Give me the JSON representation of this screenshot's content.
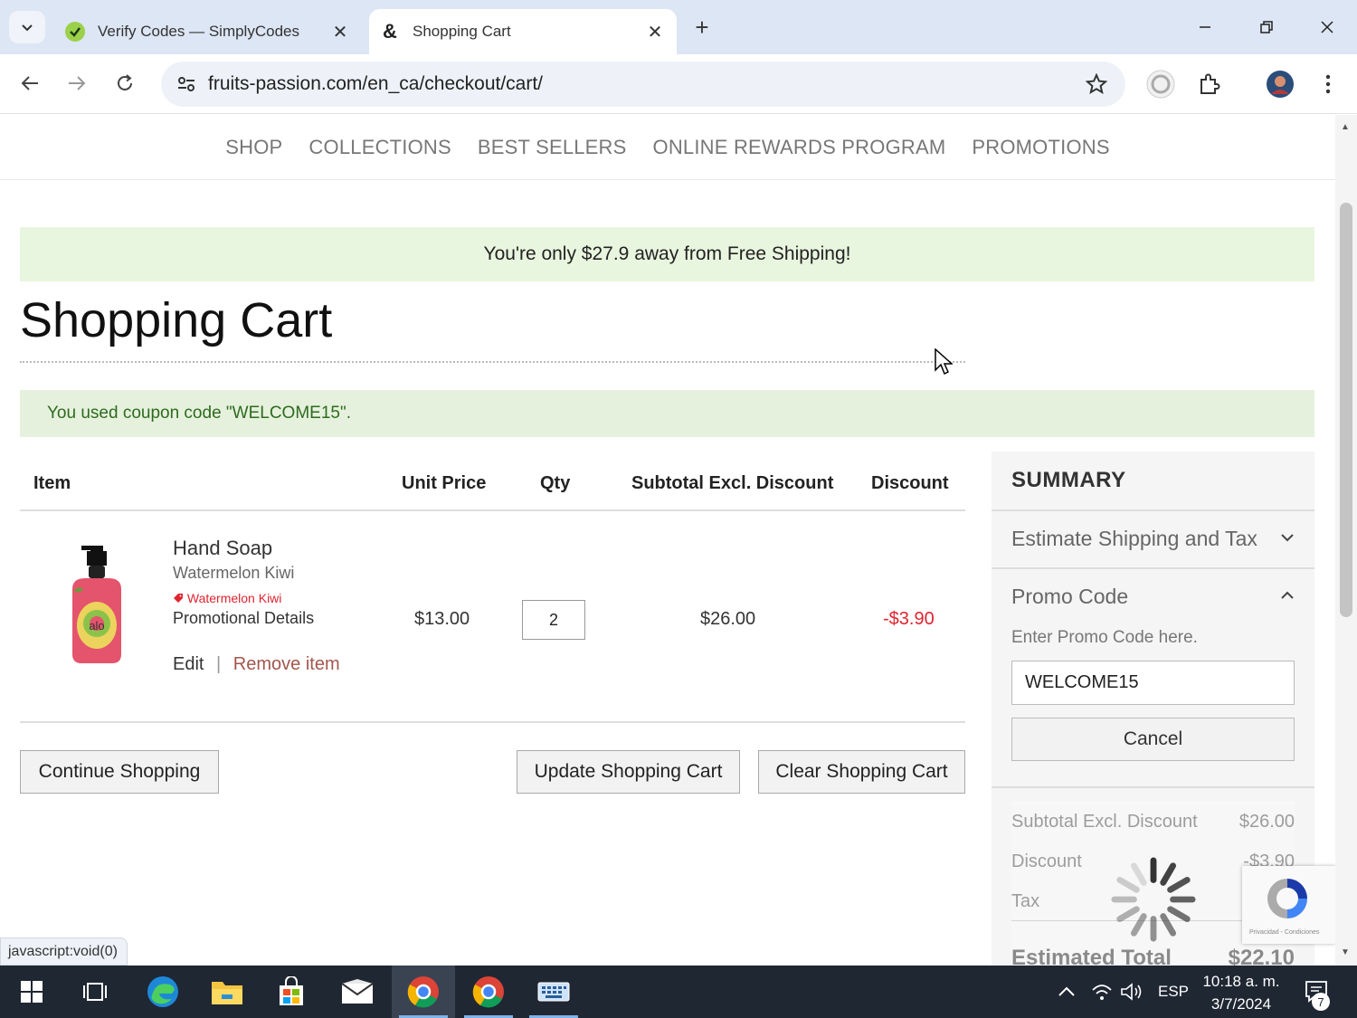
{
  "browser": {
    "tabs": [
      {
        "title": "Verify Codes — SimplyCodes",
        "active": false
      },
      {
        "title": "Shopping Cart",
        "active": true
      }
    ],
    "url": "fruits-passion.com/en_ca/checkout/cart/",
    "status_text": "javascript:void(0)"
  },
  "nav": {
    "items": [
      "SHOP",
      "COLLECTIONS",
      "BEST SELLERS",
      "ONLINE REWARDS PROGRAM",
      "PROMOTIONS"
    ]
  },
  "banner": {
    "free_shipping": "You're only $27.9 away from Free Shipping!"
  },
  "page": {
    "title": "Shopping Cart",
    "coupon_message": "You used coupon code \"WELCOME15\"."
  },
  "cart": {
    "headers": {
      "item": "Item",
      "unit_price": "Unit Price",
      "qty": "Qty",
      "subtotal": "Subtotal Excl. Discount",
      "discount": "Discount"
    },
    "items": [
      {
        "name": "Hand Soap",
        "variant": "Watermelon Kiwi",
        "promo_tag": "Watermelon Kiwi",
        "promo_details": "Promotional Details",
        "unit_price": "$13.00",
        "qty": "2",
        "subtotal": "$26.00",
        "discount": "-$3.90",
        "edit_label": "Edit",
        "separator": "|",
        "remove_label": "Remove item",
        "product_brand": "alo"
      }
    ],
    "buttons": {
      "continue": "Continue Shopping",
      "update": "Update Shopping Cart",
      "clear": "Clear Shopping Cart"
    }
  },
  "summary": {
    "title": "SUMMARY",
    "estimate_section": "Estimate Shipping and Tax",
    "promo_section": "Promo Code",
    "promo_label": "Enter Promo Code here.",
    "promo_value": "WELCOME15",
    "cancel_label": "Cancel",
    "totals": {
      "subtotal_label": "Subtotal Excl. Discount",
      "subtotal_value": "$26.00",
      "discount_label": "Discount",
      "discount_value": "-$3.90",
      "tax_label": "Tax",
      "total_label": "Estimated Total",
      "total_value": "$22.10"
    },
    "recaptcha_legal": "Privacidad - Condiciones"
  },
  "taskbar": {
    "language": "ESP",
    "time": "10:18 a. m.",
    "date": "3/7/2024",
    "notification_count": "7"
  },
  "colors": {
    "discount_red": "#e0242f",
    "coupon_green": "#2e6b1e",
    "banner_bg": "#e9f6df",
    "remove_link": "#a3564e"
  }
}
